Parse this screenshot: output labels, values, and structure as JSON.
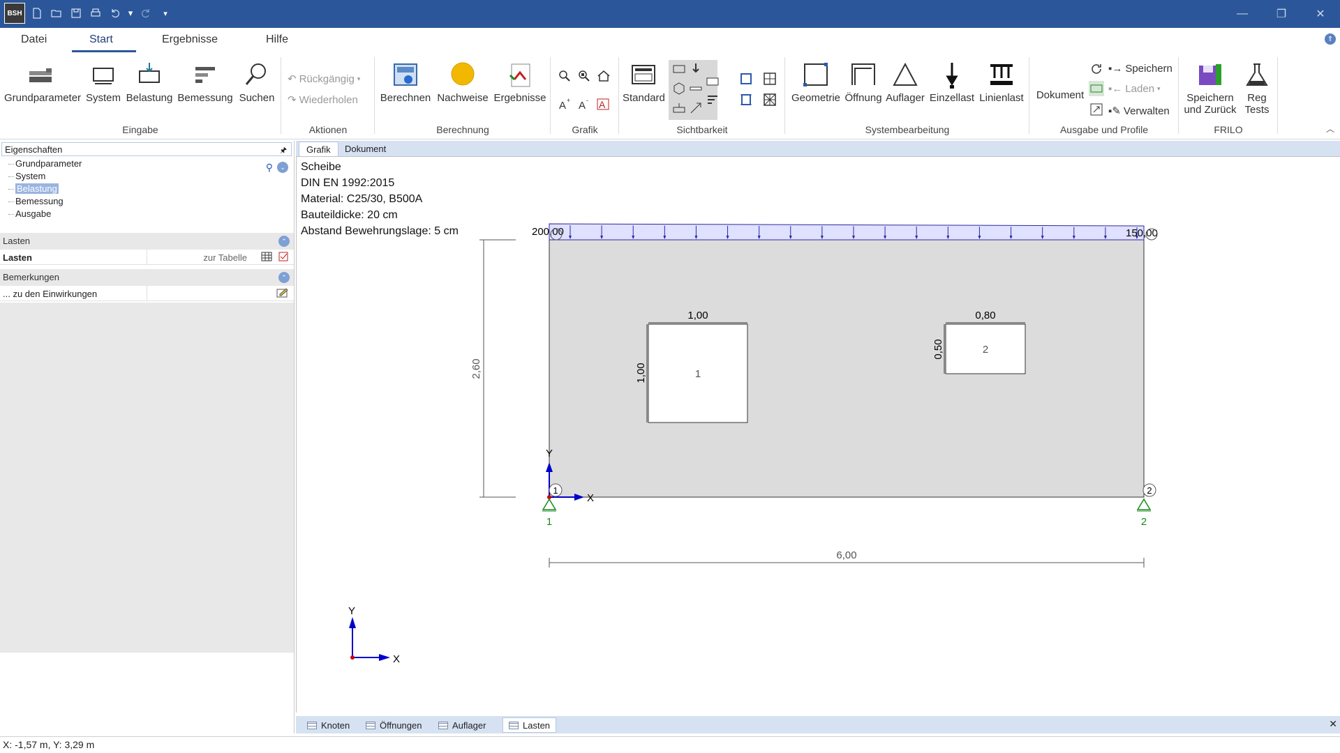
{
  "app": {
    "logo_text": "BSH"
  },
  "quick_access": [
    "new-icon",
    "open-icon",
    "save-icon",
    "print-icon",
    "undo-icon",
    "redo-icon",
    "customize-icon"
  ],
  "ribbon_tabs": [
    {
      "label": "Datei"
    },
    {
      "label": "Start",
      "active": true
    },
    {
      "label": "Ergebnisse"
    },
    {
      "label": "Hilfe"
    }
  ],
  "groups": {
    "eingabe": {
      "label": "Eingabe",
      "buttons": [
        "Grundparameter",
        "System",
        "Belastung",
        "Bemessung",
        "Suchen"
      ]
    },
    "aktionen": {
      "label": "Aktionen",
      "undo": "Rückgängig",
      "redo": "Wiederholen"
    },
    "berechnung": {
      "label": "Berechnung",
      "buttons": [
        "Berechnen",
        "Nachweise",
        "Ergebnisse"
      ]
    },
    "grafik": {
      "label": "Grafik"
    },
    "sichtbarkeit": {
      "label": "Sichtbarkeit",
      "standard": "Standard"
    },
    "systembearbeitung": {
      "label": "Systembearbeitung",
      "buttons": [
        "Geometrie",
        "Öffnung",
        "Auflager",
        "Einzellast",
        "Linienlast"
      ]
    },
    "ausgabe": {
      "label": "Ausgabe und Profile",
      "dokument": "Dokument",
      "speichern": "Speichern",
      "laden": "Laden",
      "verwalten": "Verwalten"
    },
    "frilo": {
      "label": "FRILO",
      "save_back_1": "Speichern",
      "save_back_2": "und Zurück",
      "reg_1": "Reg",
      "reg_2": "Tests"
    }
  },
  "left_panel": {
    "header": "Eigenschaften",
    "pin": "🖈",
    "tree": [
      "Grundparameter",
      "System",
      "Belastung",
      "Bemessung",
      "Ausgabe"
    ],
    "tree_selected": "Belastung",
    "lasten_section": "Lasten",
    "lasten_row": {
      "key": "Lasten",
      "value": "zur Tabelle"
    },
    "bemerkungen_section": "Bemerkungen",
    "bemerkungen_row": {
      "key": "... zu den Einwirkungen",
      "value": ""
    }
  },
  "doc_tabs": [
    {
      "label": "Grafik",
      "active": true
    },
    {
      "label": "Dokument"
    }
  ],
  "drawing": {
    "info": [
      "Scheibe",
      "DIN EN 1992:2015",
      "Material: C25/30, B500A",
      "Bauteildicke: 20 cm",
      "Abstand Bewehrungslage: 5 cm"
    ],
    "load_left": "200,00",
    "load_right": "150,00",
    "height_dim": "2,60",
    "width_dim": "6,00",
    "opening1": {
      "id": "1",
      "width": "1,00",
      "height": "1,00"
    },
    "opening2": {
      "id": "2",
      "width": "0,80",
      "height": "0,50"
    },
    "node1": "1",
    "node2": "2",
    "support1": "1",
    "support2": "2",
    "axis_x": "X",
    "axis_y": "Y"
  },
  "bottom_tabs": [
    {
      "label": "Knoten"
    },
    {
      "label": "Öffnungen"
    },
    {
      "label": "Auflager"
    },
    {
      "label": "Lasten",
      "active": true
    }
  ],
  "status": {
    "coords": "X: -1,57 m, Y: 3,29 m"
  },
  "colors": {
    "titlebar": "#2b579a",
    "load_fill": "#e0e0ff",
    "load_stroke": "#2a2aa0",
    "support": "#1a8a1a",
    "axis": "#0000cc",
    "panel_grey": "#e8e8e8"
  }
}
